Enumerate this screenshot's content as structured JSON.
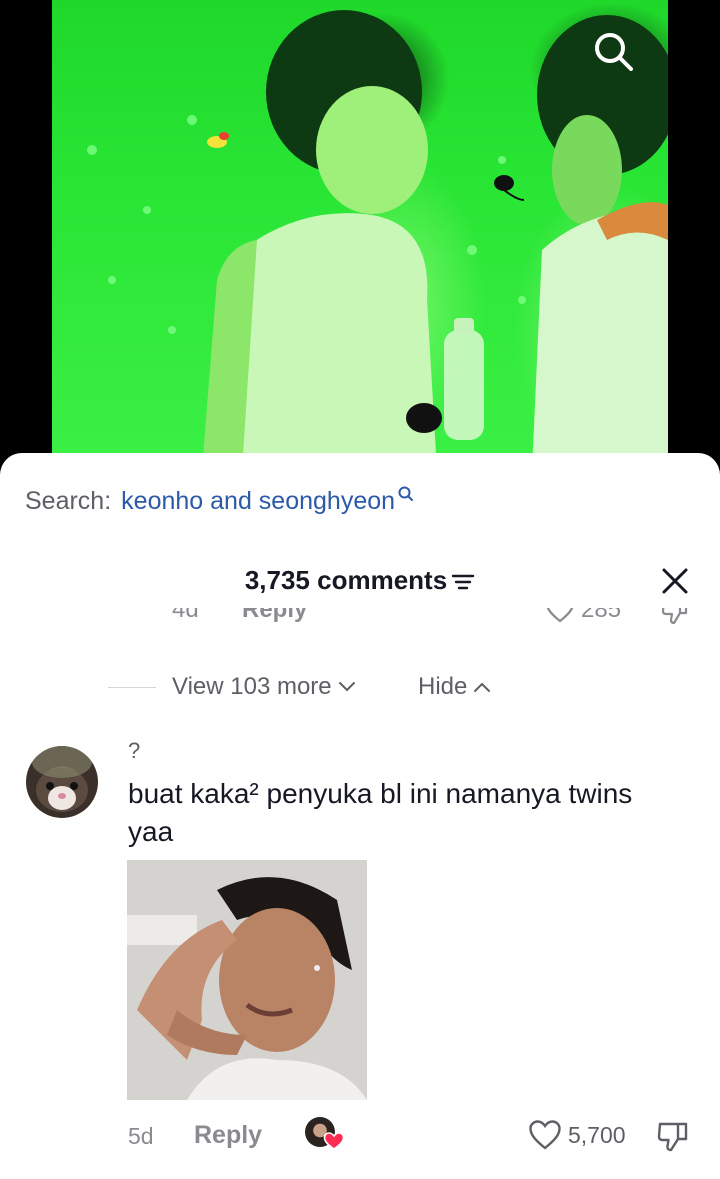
{
  "search": {
    "prefix": "Search:",
    "query": "keonho and seonghyeon"
  },
  "header": {
    "comments_count_label": "3,735 comments"
  },
  "previous_comment": {
    "time": "4d",
    "reply_label": "Reply",
    "like_count": "285"
  },
  "replies_controls": {
    "view_more_label": "View 103 more",
    "hide_label": "Hide"
  },
  "comment": {
    "username": "?",
    "text": "buat kaka² penyuka bl ini namanya twins yaa",
    "time": "5d",
    "reply_label": "Reply",
    "like_count": "5,700"
  },
  "icons": {
    "video_search": "search-icon",
    "query_search": "search-icon",
    "sort": "filter-icon",
    "close": "close-icon",
    "like": "heart-icon",
    "dislike": "thumbs-down-icon",
    "view_more": "chevron-down-icon",
    "hide": "chevron-up-icon"
  },
  "colors": {
    "link_blue": "#2c5aa8",
    "creator_heart": "#fe2c55",
    "muted_text": "#8a8b91"
  }
}
